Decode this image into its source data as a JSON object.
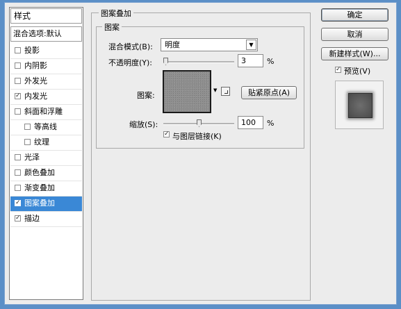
{
  "styles_panel": {
    "header": "样式",
    "blend_options": "混合选项:默认",
    "items": [
      {
        "label": "投影",
        "checked": false
      },
      {
        "label": "内阴影",
        "checked": false
      },
      {
        "label": "外发光",
        "checked": false
      },
      {
        "label": "内发光",
        "checked": true
      },
      {
        "label": "斜面和浮雕",
        "checked": false
      },
      {
        "label": "等高线",
        "checked": false
      },
      {
        "label": "纹理",
        "checked": false
      },
      {
        "label": "光泽",
        "checked": false
      },
      {
        "label": "颜色叠加",
        "checked": false
      },
      {
        "label": "渐变叠加",
        "checked": false
      },
      {
        "label": "图案叠加",
        "checked": true,
        "selected": true
      },
      {
        "label": "描边",
        "checked": true
      }
    ]
  },
  "pattern_overlay": {
    "group_title": "图案叠加",
    "subgroup_title": "图案",
    "blend_mode_label": "混合模式(B):",
    "blend_mode_value": "明度",
    "opacity_label": "不透明度(Y):",
    "opacity_value": "3",
    "opacity_unit": "%",
    "opacity_fraction": 0.03,
    "pattern_label": "图案:",
    "snap_origin_button": "贴紧原点(A)",
    "scale_label": "缩放(S):",
    "scale_value": "100",
    "scale_unit": "%",
    "scale_fraction": 0.5,
    "link_layer_label": "与图层链接(K)",
    "link_layer_checked": true
  },
  "actions": {
    "ok": "确定",
    "cancel": "取消",
    "new_style": "新建样式(W)...",
    "preview_label": "预览(V)",
    "preview_checked": true
  },
  "icons": {
    "check": "✓",
    "dropdown": "▼",
    "new_preset_icon": "page-corner-icon"
  }
}
